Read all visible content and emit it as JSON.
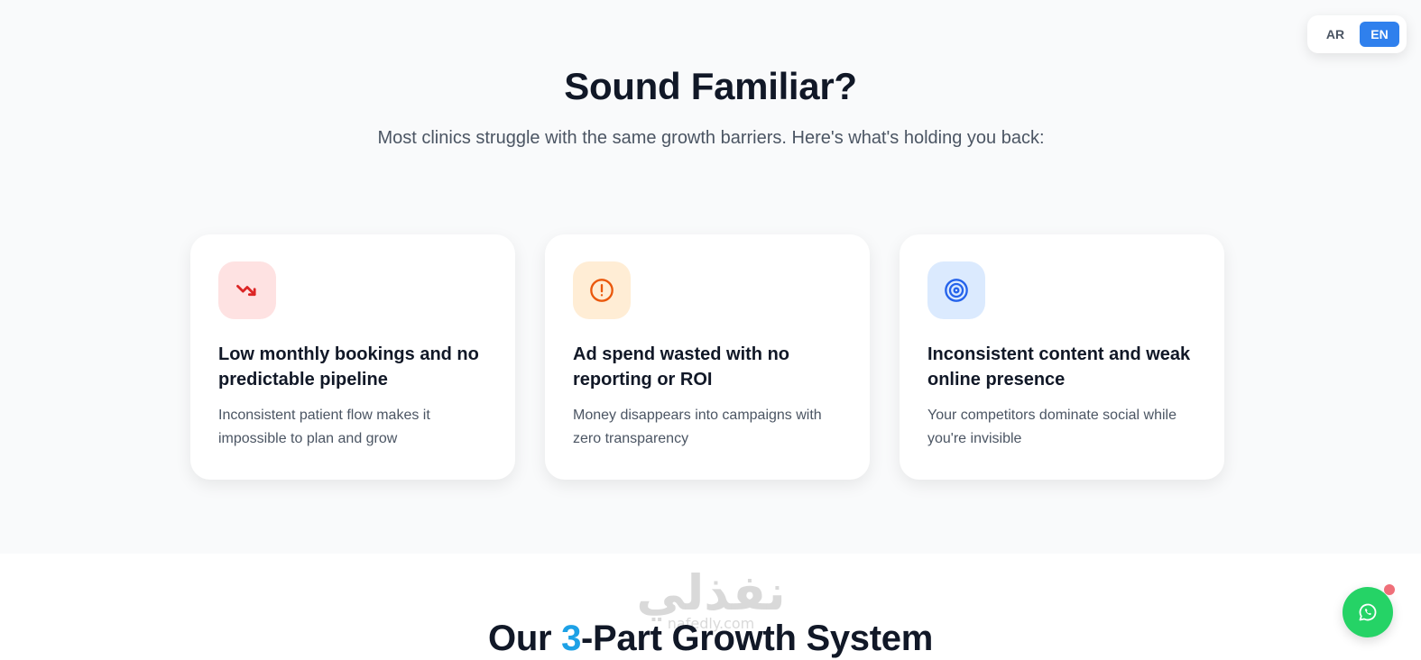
{
  "language_switch": {
    "options": [
      "AR",
      "EN"
    ],
    "selected": "EN"
  },
  "problems": {
    "title": "Sound Familiar?",
    "subtitle": "Most clinics struggle with the same growth barriers. Here's what's holding you back:",
    "cards": [
      {
        "icon": "trending-down-icon",
        "icon_color": "#dc2626",
        "icon_bg": "#fee2e2",
        "title": "Low monthly bookings and no predictable pipeline",
        "description": "Inconsistent patient flow makes it impossible to plan and grow"
      },
      {
        "icon": "alert-circle-icon",
        "icon_color": "#ea580c",
        "icon_bg": "#ffedd5",
        "title": "Ad spend wasted with no reporting or ROI",
        "description": "Money disappears into campaigns with zero transparency"
      },
      {
        "icon": "target-icon",
        "icon_color": "#2563eb",
        "icon_bg": "#dbeafe",
        "title": "Inconsistent content and weak online presence",
        "description": "Your competitors dominate social while you're invisible"
      }
    ]
  },
  "growth_system": {
    "title_before": "Our ",
    "title_accent": "3",
    "title_after": "-Part Growth System",
    "accent_color": "#1da1e6"
  },
  "watermark": {
    "text": "نفذلي",
    "subtext": "nafedly.com"
  },
  "whatsapp": {
    "icon": "whatsapp-icon",
    "color": "#25d366"
  }
}
